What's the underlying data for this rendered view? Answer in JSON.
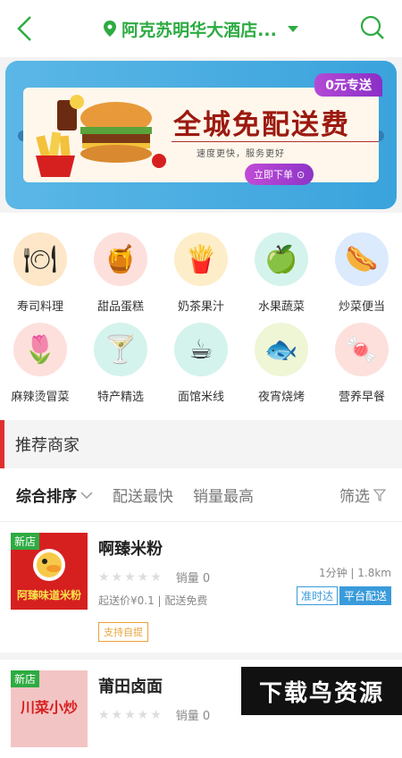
{
  "header": {
    "location": "阿克苏明华大酒店...",
    "back_icon": "chevron-left-icon",
    "search_icon": "search-icon"
  },
  "banner": {
    "badge": "0元专送",
    "title": "全城免配送费",
    "subtitle": "速度更快，服务更好",
    "button": "立即下单"
  },
  "categories": [
    {
      "label": "寿司料理",
      "icon": "cloche-icon",
      "color": "#fde7c8"
    },
    {
      "label": "甜品蛋糕",
      "icon": "jar-icon",
      "color": "#fde0dc"
    },
    {
      "label": "奶茶果汁",
      "icon": "fries-icon",
      "color": "#fdeec9"
    },
    {
      "label": "水果蔬菜",
      "icon": "apple-icon",
      "color": "#d4f3ec"
    },
    {
      "label": "炒菜便当",
      "icon": "sausage-icon",
      "color": "#dbeafd"
    },
    {
      "label": "麻辣烫冒菜",
      "icon": "tulip-icon",
      "color": "#fde0dc"
    },
    {
      "label": "特产精选",
      "icon": "cocktail-icon",
      "color": "#d4f3ec"
    },
    {
      "label": "面馆米线",
      "icon": "coffee-cup-icon",
      "color": "#d4f3ec"
    },
    {
      "label": "夜宵烧烤",
      "icon": "fish-icon",
      "color": "#eef6d5"
    },
    {
      "label": "营养早餐",
      "icon": "candy-icon",
      "color": "#fde0dc"
    }
  ],
  "section_title": "推荐商家",
  "sort": {
    "default": "综合排序",
    "fast": "配送最快",
    "sales": "销量最高",
    "filter": "筛选"
  },
  "shops": [
    {
      "badge": "新店",
      "thumb_text": "阿臻味道米粉",
      "name": "啊臻米粉",
      "sales": "销量 0",
      "eta": "1分钟 | 1.8km",
      "min_delivery": "起送价¥0.1 | 配送免费",
      "tags": [
        "准时达",
        "平台配送"
      ],
      "pickup": "支持自提"
    },
    {
      "badge": "新店",
      "thumb_text": "川菜小炒",
      "name": "莆田卤面",
      "sales": "销量 0"
    }
  ],
  "watermark": "下载鸟资源"
}
